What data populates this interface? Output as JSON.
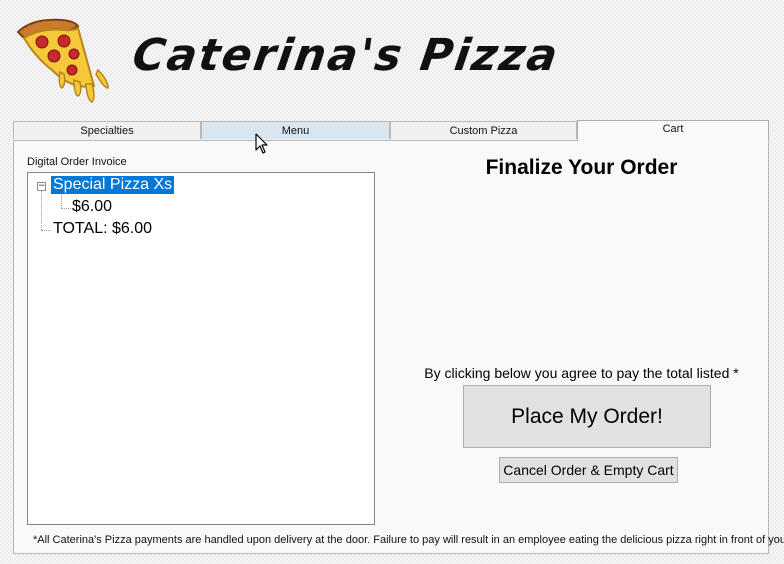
{
  "header": {
    "brand_title": "Caterina's Pizza",
    "logo_icon": "pizza-slice-icon"
  },
  "tabs": [
    {
      "label": "Specialties",
      "state": "normal"
    },
    {
      "label": "Menu",
      "state": "hover"
    },
    {
      "label": "Custom Pizza",
      "state": "normal"
    },
    {
      "label": "Cart",
      "state": "selected"
    }
  ],
  "cart": {
    "invoice_label": "Digital Order Invoice",
    "tree": {
      "root_item": "Special Pizza Xs",
      "root_price": "$6.00",
      "total": "TOTAL: $6.00"
    },
    "finalize_title": "Finalize Your Order",
    "agreement_text": "By clicking below you agree to pay the total listed *",
    "place_order_label": "Place My Order!",
    "cancel_label": "Cancel Order & Empty Cart",
    "footnote": "*All Caterina's Pizza payments are handled upon delivery at the door. Failure to pay will result in an employee eating the delicious pizza right in front of you."
  },
  "colors": {
    "selection": "#0078d7",
    "tab_hover": "#d8e6f2",
    "button_face": "#e1e1e1",
    "panel_bg": "#f9f9f9"
  },
  "cursor_icon": "arrow-pointer-icon"
}
